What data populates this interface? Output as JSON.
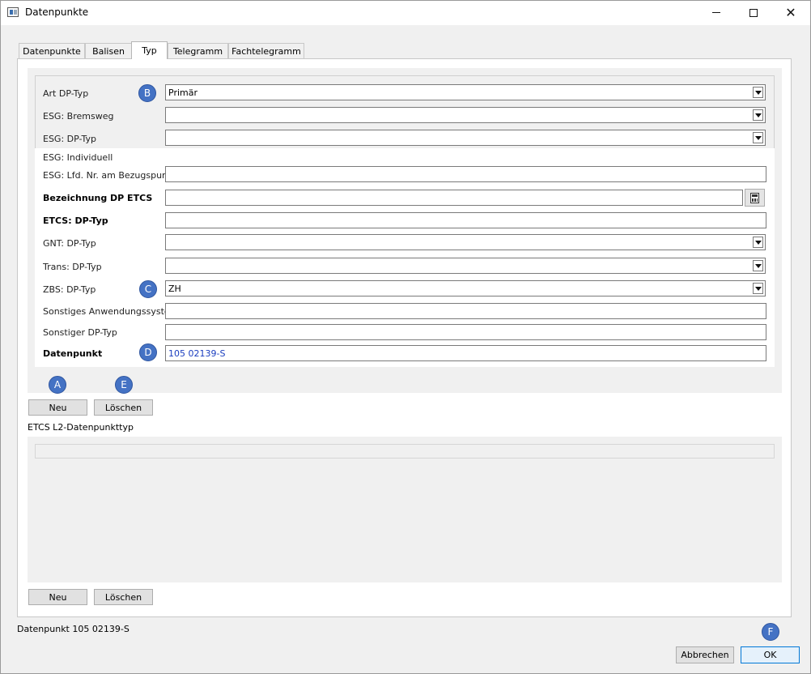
{
  "window": {
    "title": "Datenpunkte",
    "minimize": "",
    "maximize": "",
    "close": "✕"
  },
  "tabs": [
    {
      "label": "Datenpunkte",
      "active": false
    },
    {
      "label": "Balisen",
      "active": false
    },
    {
      "label": "Typ",
      "active": true
    },
    {
      "label": "Telegramm",
      "active": false
    },
    {
      "label": "Fachtelegramm",
      "active": false
    }
  ],
  "form": {
    "art_dp_typ": {
      "label": "Art DP-Typ",
      "value": "Primär"
    },
    "esg_bremsweg": {
      "label": "ESG: Bremsweg",
      "value": ""
    },
    "esg_dp_typ": {
      "label": "ESG: DP-Typ",
      "value": ""
    },
    "esg_individuell": {
      "label": "ESG: Individuell"
    },
    "esg_lfd_nr": {
      "label": "ESG: Lfd. Nr. am Bezugspunkt",
      "value": ""
    },
    "bezeichnung_dp_etcs": {
      "label": "Bezeichnung DP ETCS",
      "value": ""
    },
    "etcs_dp_typ": {
      "label": "ETCS: DP-Typ",
      "value": ""
    },
    "gnt_dp_typ": {
      "label": "GNT: DP-Typ",
      "value": ""
    },
    "trans_dp_typ": {
      "label": "Trans: DP-Typ",
      "value": ""
    },
    "zbs_dp_typ": {
      "label": "ZBS: DP-Typ",
      "value": "ZH"
    },
    "sonstiges_anwendungssystem": {
      "label": "Sonstiges Anwendungssystem",
      "value": ""
    },
    "sonstiger_dp_typ": {
      "label": "Sonstiger DP-Typ",
      "value": ""
    },
    "datenpunkt": {
      "label": "Datenpunkt",
      "value": "105 02139-S"
    }
  },
  "buttons": {
    "neu": "Neu",
    "loeschen": "Löschen",
    "abbrechen": "Abbrechen",
    "ok": "OK"
  },
  "section_l2": {
    "label": "ETCS L2-Datenpunkttyp"
  },
  "status": "Datenpunkt 105 02139-S",
  "markers": {
    "a": "A",
    "b": "B",
    "c": "C",
    "d": "D",
    "e": "E",
    "f": "F"
  },
  "colors": {
    "marker": "#4472c4",
    "datenpunkt_value": "#1a3dbf"
  }
}
